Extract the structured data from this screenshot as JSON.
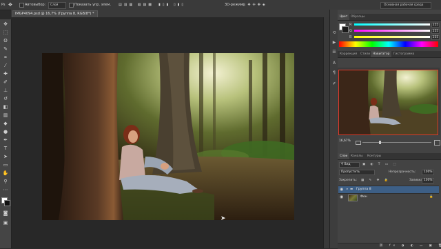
{
  "options_bar": {
    "auto_select_label": "Автовыбор:",
    "layer_select": "Слой",
    "show_transform_label": "Показать упр. элем.",
    "mode_3d_label": "3D-режим:",
    "workspace": "Основная рабочая среда"
  },
  "document": {
    "tab_title": "IMGP4094.psd @ 16,7% (Группа 8, RGB/8*) *"
  },
  "color_panel": {
    "tabs": [
      "Цвет",
      "Образцы"
    ],
    "sliders": [
      {
        "label": "R",
        "value": "255"
      },
      {
        "label": "G",
        "value": "255"
      },
      {
        "label": "B",
        "value": "255"
      }
    ]
  },
  "navigator_panel": {
    "tabs": [
      "Коррекция",
      "Стили",
      "Навигатор",
      "Гистограмма"
    ],
    "zoom": "16,67%"
  },
  "layers_panel": {
    "tabs": [
      "Слои",
      "Каналы",
      "Контуры"
    ],
    "filter_label": "Вид",
    "blend_mode": "Пропустить",
    "opacity_label": "Непрозрачность:",
    "opacity_value": "100%",
    "lock_label": "Закрепить:",
    "fill_label": "Заливка:",
    "fill_value": "100%",
    "layers": [
      {
        "name": "Группа 8",
        "selected": true
      },
      {
        "name": "Фон",
        "selected": false
      }
    ]
  },
  "colors": {
    "accent_selection": "#3d5f86",
    "navigator_frame": "#e03a2c"
  }
}
